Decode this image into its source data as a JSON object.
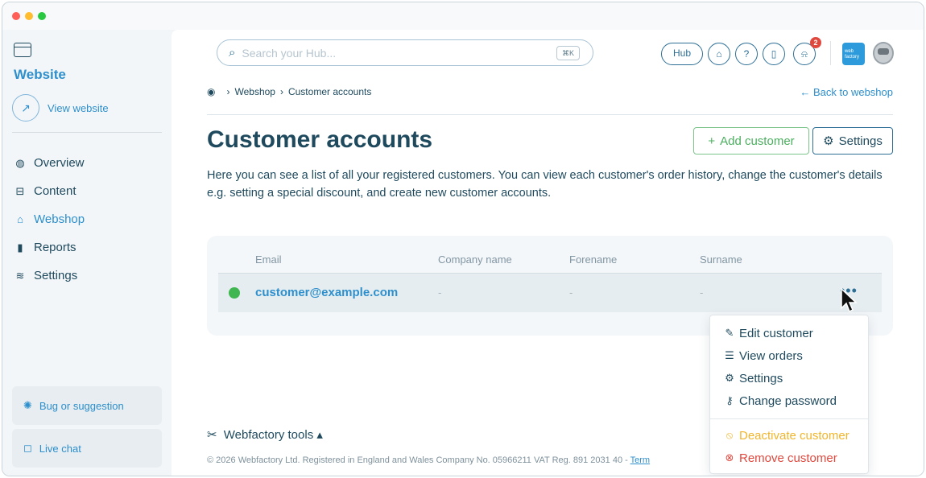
{
  "sidebar": {
    "site_title": "Website",
    "view_website": "View website",
    "nav": [
      {
        "label": "Overview",
        "icon": "overview-icon",
        "glyph": "◍"
      },
      {
        "label": "Content",
        "icon": "content-icon",
        "glyph": "⊟"
      },
      {
        "label": "Webshop",
        "icon": "basket-icon",
        "glyph": "⌂",
        "active": true
      },
      {
        "label": "Reports",
        "icon": "reports-icon",
        "glyph": "ılı"
      },
      {
        "label": "Settings",
        "icon": "sliders-icon",
        "glyph": "≋"
      }
    ],
    "bug_label": "Bug or suggestion",
    "chat_label": "Live chat"
  },
  "topbar": {
    "search_placeholder": "Search your Hub...",
    "search_shortcut": "⌘K",
    "hub_label": "Hub",
    "notification_count": "2",
    "logo_text": "web factory"
  },
  "breadcrumb": {
    "items": [
      "Webshop",
      "Customer accounts"
    ],
    "back_link": "← Back to webshop"
  },
  "page": {
    "title": "Customer accounts",
    "add_button": "Add customer",
    "settings_button": "Settings",
    "description": "Here you can see a list of all your registered customers. You can view each customer's order history, change the customer's details e.g. setting a special discount, and create new customer accounts."
  },
  "table": {
    "columns": [
      "Email",
      "Company name",
      "Forename",
      "Surname"
    ],
    "rows": [
      {
        "status": "active",
        "status_color": "#3fb64f",
        "email": "customer@example.com",
        "company": "-",
        "forename": "-",
        "surname": "-"
      }
    ]
  },
  "context_menu": {
    "items": [
      "Edit customer",
      "View orders",
      "Settings",
      "Change password"
    ],
    "deactivate": "Deactivate customer",
    "remove": "Remove customer"
  },
  "footer": {
    "tools_label": "Webfactory tools",
    "copyright": "© 2026 Webfactory Ltd. Registered in England and Wales Company No. 05966211 VAT Reg. 891 2031 40 - ",
    "terms": "Term"
  },
  "colors": {
    "accent": "#2d8fcc",
    "navy": "#1f4a5e",
    "success": "#4caf5f",
    "warning": "#f1b52c",
    "danger": "#e0483e"
  }
}
